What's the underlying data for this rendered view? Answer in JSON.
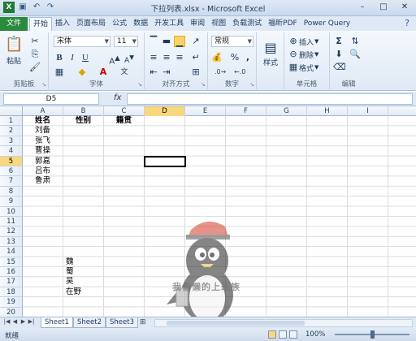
{
  "titlebar": {
    "title": "下拉列表.xlsx - Microsoft Excel",
    "qat_icons": [
      "excel-logo-icon",
      "save-icon",
      "undo-icon",
      "redo-icon"
    ]
  },
  "tabs": [
    {
      "label": "文件",
      "key": "file"
    },
    {
      "label": "开始",
      "key": "home"
    },
    {
      "label": "插入",
      "key": "insert"
    },
    {
      "label": "页面布局",
      "key": "layout"
    },
    {
      "label": "公式",
      "key": "formulas"
    },
    {
      "label": "数据",
      "key": "data"
    },
    {
      "label": "开发工具",
      "key": "dev"
    },
    {
      "label": "审阅",
      "key": "review"
    },
    {
      "label": "视图",
      "key": "view"
    },
    {
      "label": "负载测试",
      "key": "loadtest"
    },
    {
      "label": "福昕PDF",
      "key": "foxit"
    },
    {
      "label": "Power Query",
      "key": "pq"
    }
  ],
  "ribbon": {
    "clipboard": {
      "label": "剪贴板",
      "paste": "粘贴"
    },
    "font": {
      "label": "字体",
      "font_name": "宋体",
      "font_size": "11"
    },
    "alignment": {
      "label": "对齐方式"
    },
    "number": {
      "label": "数字",
      "format": "常规",
      "percent": "%",
      "comma": ","
    },
    "styles": {
      "label": "样式",
      "button": "样式"
    },
    "cells": {
      "label": "单元格",
      "insert": "插入",
      "delete": "删除",
      "format": "格式"
    },
    "editing": {
      "label": "编辑"
    }
  },
  "formula_bar": {
    "name_box": "D5",
    "fx": "fx",
    "content": ""
  },
  "columns": [
    "A",
    "B",
    "C",
    "D",
    "E",
    "F",
    "G",
    "H",
    "I"
  ],
  "rows": [
    "1",
    "2",
    "3",
    "4",
    "5",
    "6",
    "7",
    "8",
    "9",
    "10",
    "11",
    "12",
    "13",
    "14",
    "15",
    "16",
    "17",
    "18",
    "19",
    "20"
  ],
  "active_cell": {
    "col": "D",
    "row": "5"
  },
  "cells": {
    "A1": "姓名",
    "B1": "性别",
    "C1": "籍贯",
    "A2": "刘备",
    "A3": "张飞",
    "A4": "曹操",
    "A5": "郭嘉",
    "A6": "吕布",
    "A7": "鲁肃",
    "B15": "魏",
    "B16": "蜀",
    "B17": "吴",
    "B18": "在野"
  },
  "watermark": {
    "text": "我偷懒的上班族"
  },
  "sheet_tabs": [
    "Sheet1",
    "Sheet2",
    "Sheet3"
  ],
  "active_sheet": "Sheet1",
  "status": {
    "ready": "就绪",
    "zoom": "100%"
  }
}
